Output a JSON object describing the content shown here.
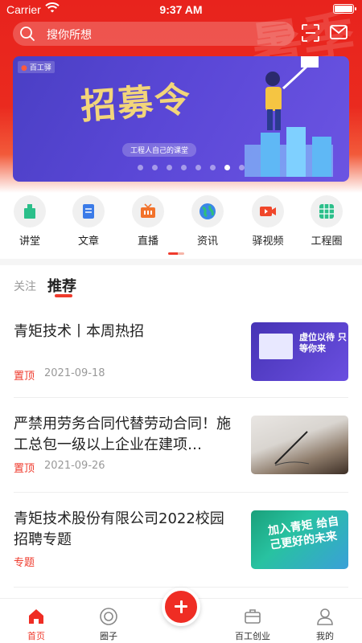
{
  "status_bar": {
    "carrier": "Carrier",
    "time": "9:37 AM"
  },
  "header": {
    "decoration_text": "暑季",
    "search_placeholder": "搜你所想"
  },
  "banner": {
    "logo": "百工驿",
    "title": "招募令",
    "subtitle": "工程人自己的课堂",
    "slide_count": 8,
    "active_slide": 6
  },
  "categories": [
    {
      "label": "讲堂",
      "icon": "lectern-icon"
    },
    {
      "label": "文章",
      "icon": "document-icon"
    },
    {
      "label": "直播",
      "icon": "tv-live-icon"
    },
    {
      "label": "资讯",
      "icon": "globe-icon"
    },
    {
      "label": "驿视频",
      "icon": "video-camera-icon"
    },
    {
      "label": "工程圈",
      "icon": "grid-icon"
    }
  ],
  "feed_tabs": {
    "follow": "关注",
    "recommend": "推荐"
  },
  "articles": [
    {
      "title": "青矩技术丨本周热招",
      "tag": "置顶",
      "date": "2021-09-18",
      "thumb_text": "虚位以待 只等你来"
    },
    {
      "title": "严禁用劳务合同代替劳动合同！施工总包一级以上企业在建项…",
      "tag": "置顶",
      "date": "2021-09-26"
    },
    {
      "title": "青矩技术股份有限公司2022校园招聘专题",
      "tag": "专题",
      "date": "",
      "thumb_text": "加入青矩 给自己更好的未来"
    }
  ],
  "tabbar": [
    {
      "label": "首页",
      "icon": "home-icon",
      "active": true
    },
    {
      "label": "圈子",
      "icon": "circle-icon"
    },
    {
      "label": "百工创业",
      "icon": "briefcase-icon"
    },
    {
      "label": "我的",
      "icon": "user-icon"
    }
  ],
  "colors": {
    "brand": "#ef2d24",
    "banner": "#5a47d6"
  }
}
